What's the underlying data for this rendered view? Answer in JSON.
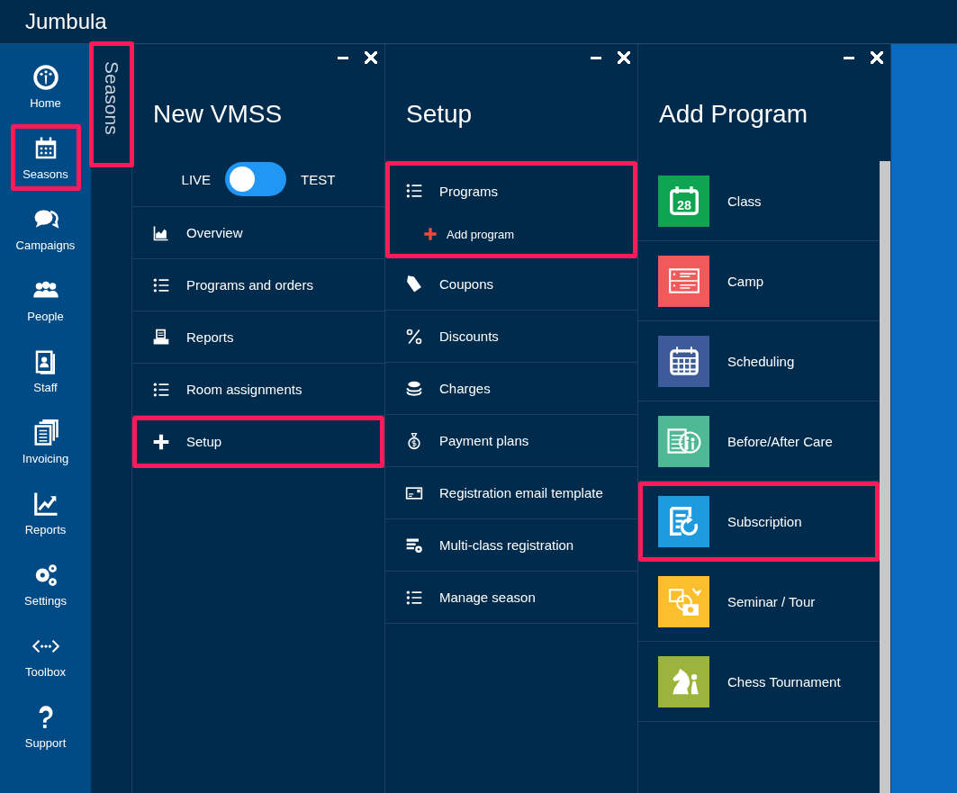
{
  "app": {
    "title": "Jumbula"
  },
  "nav": [
    {
      "label": "Home",
      "kind": "gauge",
      "highlighted": false
    },
    {
      "label": "Seasons",
      "kind": "calendar",
      "highlighted": true
    },
    {
      "label": "Campaigns",
      "kind": "chat",
      "highlighted": false
    },
    {
      "label": "People",
      "kind": "people",
      "highlighted": false
    },
    {
      "label": "Staff",
      "kind": "badge",
      "highlighted": false
    },
    {
      "label": "Invoicing",
      "kind": "docs",
      "highlighted": false
    },
    {
      "label": "Reports",
      "kind": "chart",
      "highlighted": false
    },
    {
      "label": "Settings",
      "kind": "gears",
      "highlighted": false
    },
    {
      "label": "Toolbox",
      "kind": "code",
      "highlighted": false
    },
    {
      "label": "Support",
      "kind": "question",
      "highlighted": false
    }
  ],
  "breadcrumb": {
    "label": "Seasons",
    "highlighted": true
  },
  "season_panel": {
    "title": "New VMSS",
    "toggle": {
      "left_label": "LIVE",
      "right_label": "TEST",
      "test": false
    },
    "items": [
      {
        "label": "Overview",
        "kind": "area",
        "highlighted": false
      },
      {
        "label": "Programs and orders",
        "kind": "list",
        "highlighted": false
      },
      {
        "label": "Reports",
        "kind": "printer",
        "highlighted": false
      },
      {
        "label": "Room assignments",
        "kind": "list",
        "highlighted": false
      },
      {
        "label": "Setup",
        "kind": "plus",
        "highlighted": true
      }
    ]
  },
  "setup_panel": {
    "title": "Setup",
    "items": [
      {
        "label": "Programs",
        "kind": "list",
        "highlighted": true,
        "sub_action": "Add program"
      },
      {
        "label": "Coupons",
        "kind": "tag",
        "highlighted": false
      },
      {
        "label": "Discounts",
        "kind": "percent",
        "highlighted": false
      },
      {
        "label": "Charges",
        "kind": "coins",
        "highlighted": false
      },
      {
        "label": "Payment plans",
        "kind": "bag",
        "highlighted": false
      },
      {
        "label": "Registration email template",
        "kind": "card",
        "highlighted": false
      },
      {
        "label": "Multi-class registration",
        "kind": "formgear",
        "highlighted": false
      },
      {
        "label": "Manage season",
        "kind": "list",
        "highlighted": false
      }
    ]
  },
  "add_program_panel": {
    "title": "Add Program",
    "items": [
      {
        "label": "Class",
        "kind": "cal28",
        "icon_text": "28",
        "color": "#0fa550",
        "highlighted": false
      },
      {
        "label": "Camp",
        "kind": "form",
        "color": "#f05a5a",
        "highlighted": false
      },
      {
        "label": "Scheduling",
        "kind": "calgrid",
        "color": "#3d5a9a",
        "highlighted": false
      },
      {
        "label": "Before/After Care",
        "kind": "care",
        "color": "#4fb996",
        "highlighted": false
      },
      {
        "label": "Subscription",
        "kind": "subscr",
        "color": "#1e9be0",
        "highlighted": true
      },
      {
        "label": "Seminar / Tour",
        "kind": "seminar",
        "color": "#fbbe2d",
        "highlighted": false
      },
      {
        "label": "Chess Tournament",
        "kind": "chess",
        "color": "#9cb43c",
        "highlighted": false
      }
    ]
  }
}
